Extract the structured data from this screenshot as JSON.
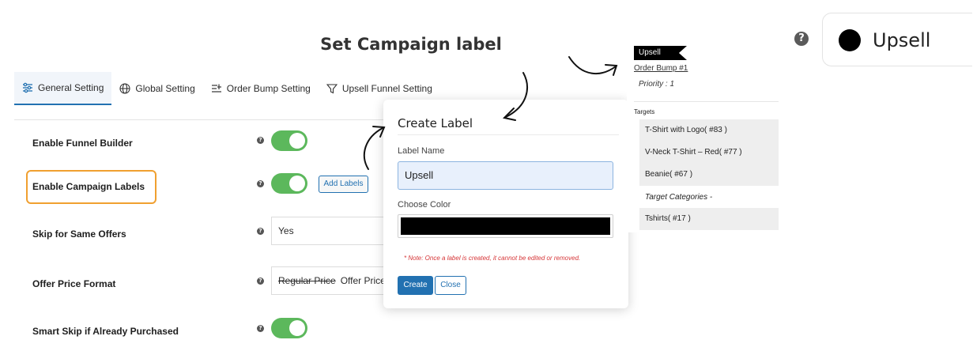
{
  "page": {
    "heading": "Set Campaign label"
  },
  "tabs": [
    {
      "label": "General Setting",
      "icon": "sliders-icon",
      "active": true
    },
    {
      "label": "Global Setting",
      "icon": "globe-icon"
    },
    {
      "label": "Order Bump Setting",
      "icon": "list-settings-icon"
    },
    {
      "label": "Upsell Funnel Setting",
      "icon": "funnel-icon"
    }
  ],
  "settings": {
    "enable_funnel_builder": {
      "label": "Enable Funnel Builder",
      "enabled": true
    },
    "enable_campaign_labels": {
      "label": "Enable Campaign Labels",
      "enabled": true,
      "add_button": "Add Labels"
    },
    "skip_same_offers": {
      "label": "Skip for Same Offers",
      "value": "Yes"
    },
    "offer_price_format": {
      "label": "Offer Price Format",
      "value_strike": "Regular Price",
      "value": "Offer Price"
    },
    "smart_skip": {
      "label": "Smart Skip if Already Purchased",
      "enabled": true
    }
  },
  "modal": {
    "title": "Create Label",
    "name_label": "Label Name",
    "name_value": "Upsell",
    "color_label": "Choose Color",
    "color_value": "#000000",
    "note": "* Note: Once a label is created, it cannot be edited or removed.",
    "create_button": "Create",
    "close_button": "Close"
  },
  "preview_panel": {
    "flag_label": "Upsell",
    "bump_link": "Order Bump #1",
    "priority": "Priority : 1",
    "targets_heading": "Targets",
    "targets": [
      "T-Shirt with Logo( #83 )",
      "V-Neck T-Shirt – Red( #77 )",
      "Beanie( #67 )"
    ],
    "target_categories_heading": "Target Categories -",
    "categories": [
      "Tshirts( #17 )"
    ]
  },
  "label_preview": {
    "help": "?",
    "text": "Upsell",
    "color": "#000000"
  },
  "help_glyph": "?",
  "colors": {
    "accent": "#2271b1",
    "toggle_on": "#5cb85c",
    "highlight": "#f0a030",
    "note": "#d63638"
  }
}
